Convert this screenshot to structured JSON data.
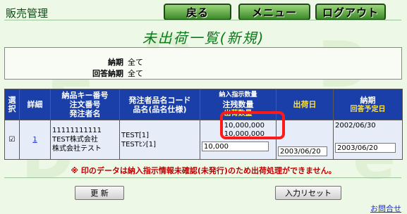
{
  "header": {
    "title": "販売管理",
    "buttons": {
      "back": "戻る",
      "menu": "メニュー",
      "logout": "ログアウト"
    }
  },
  "page_title": "未出荷一覧(新規)",
  "filters": [
    {
      "label": "納期",
      "value": "全て"
    },
    {
      "label": "回答納期",
      "value": "全て"
    }
  ],
  "table": {
    "headers": {
      "select": "選択",
      "detail": "詳細",
      "col3_line1": "納品キー番号",
      "col3_line2": "注文番号",
      "col3_line3": "発注者名",
      "col4_line1": "発注者品名コード",
      "col4_line2": "品名(品名仕様)",
      "col5_line1": "納入指示数量",
      "col5_line2": "注残数量",
      "col5_line3": "出荷数量",
      "col6": "出荷日",
      "col7_line1": "納期",
      "col7_line2": "回答予定日"
    },
    "rows": [
      {
        "checked": "☑",
        "detail_link": "1",
        "key_no": "11111111111",
        "order_no": "TEST株式会社",
        "orderer": "株式会社テスト",
        "item_code": "TEST[1]",
        "item_name": "TESTﾋﾝ[1]",
        "qty_instructed": "10,000,000",
        "qty_remaining": "10,000,000",
        "qty_ship": "10,000",
        "ship_date": "2003/06/20",
        "due_date": "2002/06/30",
        "answer_date": "2003/06/20"
      }
    ]
  },
  "warning": "※ 印のデータは納入指示情報未確認(未発行)のため出荷処理ができません。",
  "buttons": {
    "update": "更 新",
    "reset": "入力リセット"
  },
  "contact_link": "お問合せ"
}
